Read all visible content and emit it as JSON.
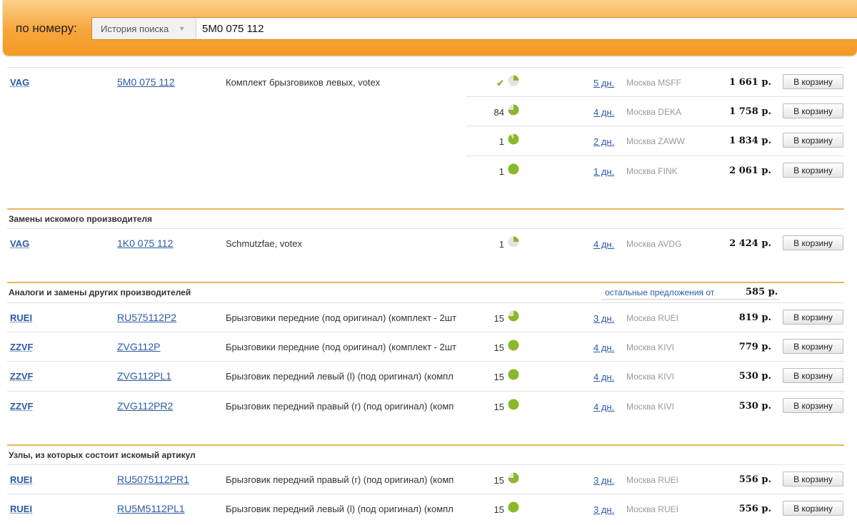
{
  "search": {
    "label": "по номеру:",
    "history_label": "История поиска",
    "value": "5M0 075 112"
  },
  "cart_label": "В корзину",
  "colors": {
    "accent": "#f49a24",
    "link": "#2b5aa6",
    "stock": "#8ab82a",
    "divider": "#e8b856"
  },
  "icons": {
    "availability": "pie-chart-icon",
    "in_stock": "check-icon",
    "dropdown": "caret-down-icon"
  },
  "main_rows": [
    {
      "brand": "VAG",
      "article": "5M0 075 112",
      "description": "Комплект брызговиков левых, votex",
      "qty": "",
      "check": "✔",
      "stock_level": 0.25,
      "days": "5 дн.",
      "warehouse": "Москва MSFF",
      "price": "1 661 р."
    },
    {
      "brand": "",
      "article": "",
      "description": "",
      "qty": "84",
      "check": "",
      "stock_level": 0.75,
      "days": "4 дн.",
      "warehouse": "Москва DEKA",
      "price": "1 758 р."
    },
    {
      "brand": "",
      "article": "",
      "description": "",
      "qty": "1",
      "check": "",
      "stock_level": 0.9,
      "days": "2 дн.",
      "warehouse": "Москва ZAWW",
      "price": "1 834 р."
    },
    {
      "brand": "",
      "article": "",
      "description": "",
      "qty": "1",
      "check": "",
      "stock_level": 1.0,
      "days": "1 дн.",
      "warehouse": "Москва FINK",
      "price": "2 061 р."
    }
  ],
  "sections": [
    {
      "title": "Замены искомого производителя",
      "others_label": "",
      "others_price": "",
      "rows": [
        {
          "brand": "VAG",
          "article": "1K0 075 112",
          "description": "Schmutzfae, votex",
          "qty": "1",
          "check": "",
          "stock_level": 0.25,
          "days": "4 дн.",
          "warehouse": "Москва AVDG",
          "price": "2 424 р."
        }
      ]
    },
    {
      "title": "Аналоги и замены других производителей",
      "others_label": "остальные предложения от",
      "others_price": "585 р.",
      "rows": [
        {
          "brand": "RUEI",
          "article": "RU575112P2",
          "description": "Брызговики передние (под оригинал) (комплект - 2шт",
          "qty": "15",
          "check": "",
          "stock_level": 0.75,
          "days": "3 дн.",
          "warehouse": "Москва RUEI",
          "price": "819 р."
        },
        {
          "brand": "ZZVF",
          "article": "ZVG112P",
          "description": "Брызговики передние (под оригинал) (комплект - 2шт",
          "qty": "15",
          "check": "",
          "stock_level": 1.0,
          "days": "4 дн.",
          "warehouse": "Москва KIVI",
          "price": "779 р."
        },
        {
          "brand": "ZZVF",
          "article": "ZVG112PL1",
          "description": "Брызговик передний левый (l) (под оригинал) (компл",
          "qty": "15",
          "check": "",
          "stock_level": 1.0,
          "days": "4 дн.",
          "warehouse": "Москва KIVI",
          "price": "530 р."
        },
        {
          "brand": "ZZVF",
          "article": "ZVG112PR2",
          "description": "Брызговик передний правый (r) (под оригинал) (комп",
          "qty": "15",
          "check": "",
          "stock_level": 1.0,
          "days": "4 дн.",
          "warehouse": "Москва KIVI",
          "price": "530 р."
        }
      ]
    },
    {
      "title": "Узлы, из которых состоит искомый артикул",
      "others_label": "",
      "others_price": "",
      "rows": [
        {
          "brand": "RUEI",
          "article": "RU5075112PR1",
          "description": "Брызговик передний правый (r) (под оригинал) (комп",
          "qty": "15",
          "check": "",
          "stock_level": 0.75,
          "days": "3 дн.",
          "warehouse": "Москва RUEI",
          "price": "556 р."
        },
        {
          "brand": "RUEI",
          "article": "RU5M5112PL1",
          "description": "Брызговик передний левый (l) (под оригинал) (компл",
          "qty": "15",
          "check": "",
          "stock_level": 1.0,
          "days": "3 дн.",
          "warehouse": "Москва RUEI",
          "price": "556 р."
        }
      ]
    }
  ]
}
